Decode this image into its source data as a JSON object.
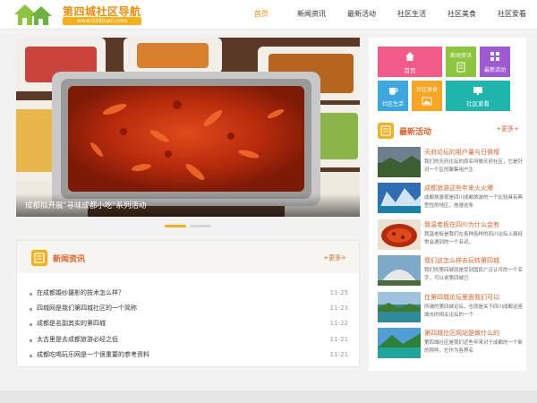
{
  "header": {
    "logo_title": "第四城社区导航",
    "logo_url": "www.028tuan.com"
  },
  "nav": [
    {
      "label": "首页",
      "active": true
    },
    {
      "label": "新闻资讯"
    },
    {
      "label": "最新活动"
    },
    {
      "label": "社区生活"
    },
    {
      "label": "社区美食"
    },
    {
      "label": "社区爱看"
    }
  ],
  "banner": {
    "caption": "成都拟开展\"寻味成都小吃\"系列活动"
  },
  "news": {
    "title": "新闻资讯",
    "more": "+更多+",
    "items": [
      {
        "title": "在成都婚纱摄影的技术怎么样？",
        "date": "11-25"
      },
      {
        "title": "四城网是我们第四城社区的一个简称",
        "date": "11-23"
      },
      {
        "title": "成都是名副其实的第四城",
        "date": "11-22"
      },
      {
        "title": "太古里是去成都旅游必经之低",
        "date": "11-21"
      },
      {
        "title": "成都吃喝玩乐网是一个很重要的参考资料",
        "date": "11-21"
      }
    ]
  },
  "tiles": {
    "home": "首页",
    "news": "新闻资讯",
    "activities": "最新活动",
    "life": "社区生活",
    "food": "社区美食",
    "watch": "社区爱看"
  },
  "activities": {
    "title": "最新活动",
    "more": "+更多+",
    "items": [
      {
        "title": "天府论坛的用户量与日俱增",
        "desc": "我们的天府论坛的原名叫做天府社区，它是针对一个区的聚集用户生"
      },
      {
        "title": "成都旅游这些年来火火爆",
        "desc": "成都旅游现是四川成都旅游的一个比较具有典型性的地区，他遵这条"
      },
      {
        "title": "我温老板在四川为什么会有",
        "desc": "我温老板是我们在各种各样的四川论坛上面经常会遇到的一个名词，"
      },
      {
        "title": "我们这怎么样去玩转第四城",
        "desc": "我们的第四城就是受到国民广泛认可的一个名字，可以说第四城已"
      },
      {
        "title": "在第四城论坛里面我们可以",
        "desc": "所谓的第四城论坛，也就是关于四川成都这座城市的相关论坛的一个"
      },
      {
        "title": "第四城社区网站是做什么的",
        "desc": "第四城社区是我们近些年来对于成都的一个新的称呼，它作为各界名"
      }
    ]
  },
  "colors": {
    "accent": "#f6b019",
    "title": "#e0622a",
    "tile_pink": "#f05b8a",
    "tile_green": "#8cc63f",
    "tile_purple": "#a05ad1",
    "tile_blue": "#3ea7e0",
    "tile_orange": "#f6a623",
    "tile_teal": "#1fb5ad"
  }
}
